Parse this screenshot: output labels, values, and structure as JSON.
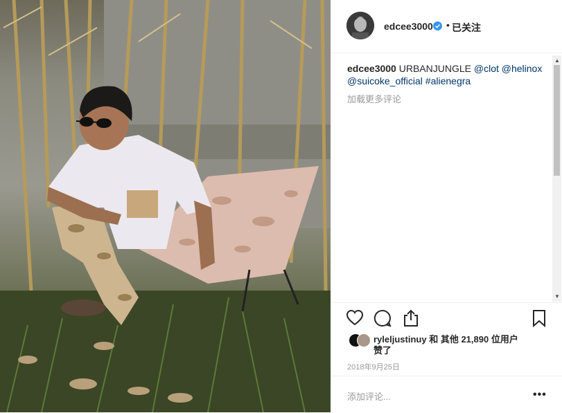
{
  "post": {
    "username": "edcee3000",
    "follow_label": "已关注",
    "separator": "•",
    "caption": {
      "username": "edcee3000",
      "text": "URBANJUNGLE",
      "links": [
        "@clot",
        "@helinox",
        "@suicoke_official",
        "#alienegra"
      ]
    },
    "load_more_comments": "加载更多评论",
    "likes": {
      "liker": "ryleljustinuy",
      "joiner": "和",
      "others": "其他 21,890 位用户",
      "suffix": "赞了"
    },
    "date": "2018年9月25日",
    "comment_placeholder": "添加评论...",
    "more_options": "•••"
  },
  "icons": {
    "like": "heart-icon",
    "comment": "comment-icon",
    "share": "share-icon",
    "save": "bookmark-icon",
    "verified": "verified-badge-icon"
  },
  "colors": {
    "verified": "#3897f0",
    "link": "#003569",
    "muted": "#999999"
  }
}
